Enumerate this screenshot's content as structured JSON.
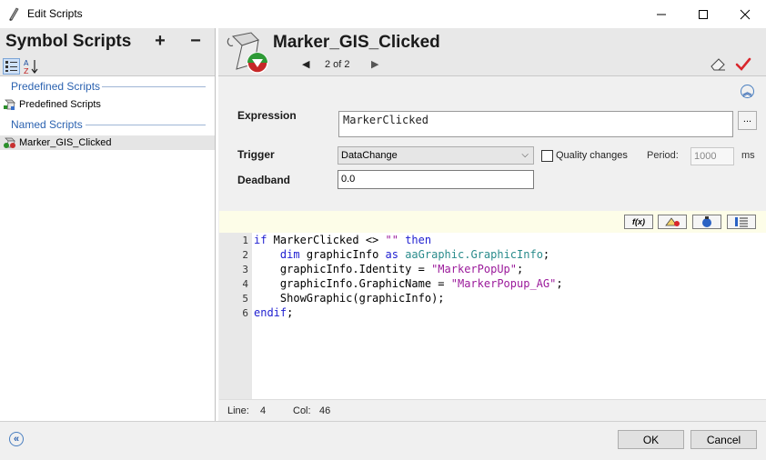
{
  "window": {
    "title": "Edit Scripts",
    "minimize_label": "Minimize",
    "maximize_label": "Maximize",
    "close_label": "Close"
  },
  "left_panel": {
    "title": "Symbol Scripts",
    "add_label": "+",
    "remove_label": "−",
    "groups": [
      {
        "label": "Predefined Scripts",
        "items": [
          {
            "label": "Predefined Scripts"
          }
        ]
      },
      {
        "label": "Named Scripts",
        "items": [
          {
            "label": "Marker_GIS_Clicked",
            "selected": true
          }
        ]
      }
    ]
  },
  "right_panel": {
    "title": "Marker_GIS_Clicked",
    "pager": "2 of 2",
    "expression": {
      "label": "Expression",
      "value": "MarkerClicked",
      "ellipsis": "..."
    },
    "trigger": {
      "label": "Trigger",
      "value": "DataChange"
    },
    "quality_changes": {
      "label": "Quality changes",
      "checked": false
    },
    "period": {
      "label": "Period:",
      "value": "1000",
      "unit": "ms"
    },
    "deadband": {
      "label": "Deadband",
      "value": "0.0"
    },
    "code_lines": [
      "if MarkerClicked <> \"\" then",
      "    dim graphicInfo as aaGraphic.GraphicInfo;",
      "    graphicInfo.Identity = \"MarkerPopUp\";",
      "    graphicInfo.GraphicName = \"MarkerPopup_AG\";",
      "    ShowGraphic(graphicInfo);",
      "endif;"
    ],
    "line_numbers": [
      "1",
      "2",
      "3",
      "4",
      "5",
      "6"
    ],
    "code_tokens": {
      "l1_kw1": "if",
      "l1_mid": " MarkerClicked <> ",
      "l1_str": "\"\"",
      "l1_kw2": "then",
      "l2_pre": "    ",
      "l2_kw1": "dim",
      "l2_mid": " graphicInfo ",
      "l2_kw2": "as",
      "l2_ty": "aaGraphic.GraphicInfo",
      "l2_end": ";",
      "l3_pre": "    graphicInfo.Identity = ",
      "l3_str": "\"MarkerPopUp\"",
      "l3_end": ";",
      "l4_pre": "    graphicInfo.GraphicName = ",
      "l4_str": "\"MarkerPopup_AG\"",
      "l4_end": ";",
      "l5": "    ShowGraphic(graphicInfo);",
      "l6_kw": "endif",
      "l6_end": ";"
    },
    "status": {
      "line_label": "Line:",
      "line_value": "4",
      "col_label": "Col:",
      "col_value": "46"
    }
  },
  "buttons": {
    "ok": "OK",
    "cancel": "Cancel"
  },
  "colors": {
    "accent": "#2b62b0",
    "keyword": "#1f1fd1",
    "type": "#2a8c8c",
    "string": "#9b1b9b",
    "apply": "#d9262c"
  }
}
